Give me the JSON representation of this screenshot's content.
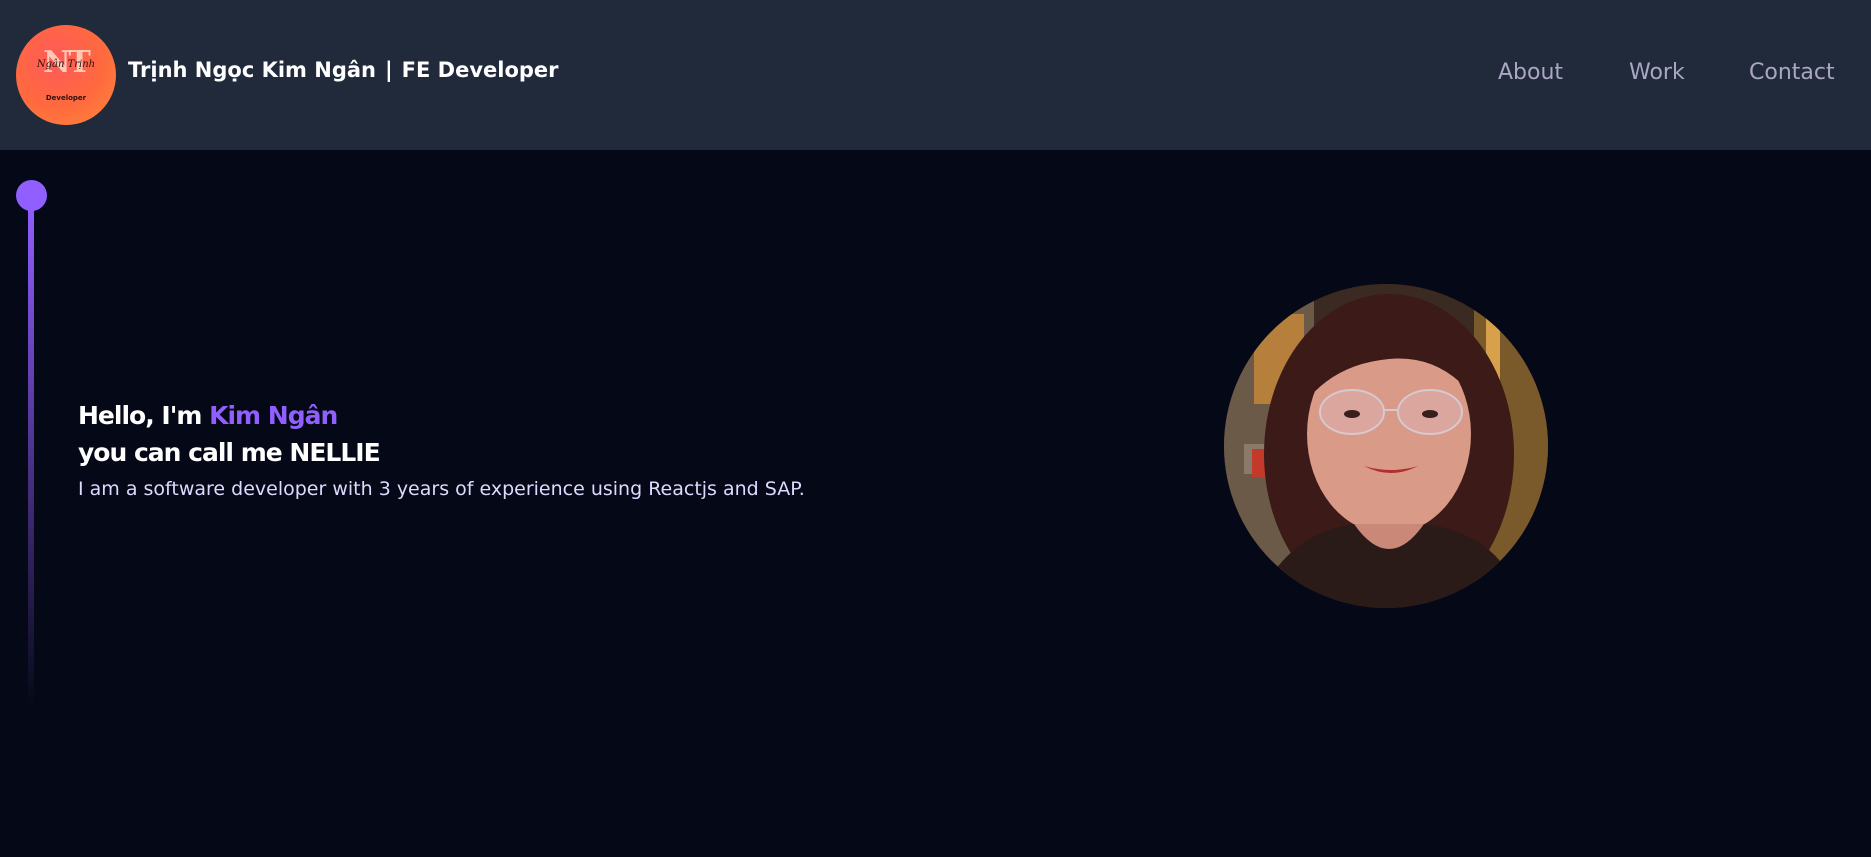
{
  "header": {
    "logo": {
      "monogram": "NT",
      "script": "Ngân Trịnh",
      "tag": "Developer"
    },
    "title_name": "Trịnh Ngọc Kim Ngân",
    "title_separator": "|",
    "title_role": "FE Developer",
    "nav": [
      {
        "label": "About"
      },
      {
        "label": "Work"
      },
      {
        "label": "Contact"
      }
    ]
  },
  "hero": {
    "greeting_prefix": "Hello, I'm ",
    "greeting_name": "Kim Ngân",
    "line2": "you can call me NELLIE",
    "description": "I am a software developer with 3 years of experience using Reactjs and SAP."
  },
  "colors": {
    "background": "#050816",
    "header_bg": "#202a3b",
    "accent": "#915eff",
    "nav_text": "#aaa6c3",
    "desc_text": "#dfd9ff"
  }
}
